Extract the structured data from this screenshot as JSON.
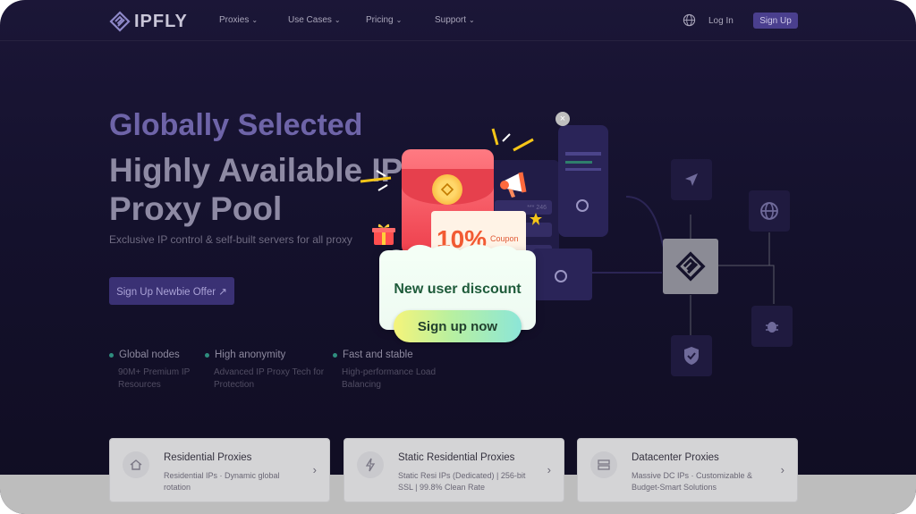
{
  "brand": {
    "name": "IPFLY"
  },
  "nav": {
    "items": [
      {
        "label": "Proxies"
      },
      {
        "label": "Use Cases"
      },
      {
        "label": "Pricing"
      },
      {
        "label": "Support"
      }
    ],
    "login_label": "Log In",
    "signup_label": "Sign Up"
  },
  "hero": {
    "title_line1": "Globally Selected",
    "title_line2": "Highly Available IP",
    "title_line3": "Proxy Pool",
    "subtitle": "Exclusive IP control & self-built servers for all proxy",
    "cta_label": "Sign Up Newbie Offer ↗",
    "features": [
      {
        "title": "Global nodes",
        "desc": "90M+ Premium IP Resources"
      },
      {
        "title": "High anonymity",
        "desc": "Advanced IP Proxy Tech for Protection"
      },
      {
        "title": "Fast and stable",
        "desc": "High-performance Load Balancing"
      }
    ]
  },
  "cards": [
    {
      "title": "Residential Proxies",
      "desc": "Residential IPs · Dynamic global rotation",
      "icon": "home-icon"
    },
    {
      "title": "Static Residential Proxies",
      "desc": "Static Resi IPs (Dedicated) | 256-bit SSL | 99.8% Clean Rate",
      "icon": "bolt-icon"
    },
    {
      "title": "Datacenter Proxies",
      "desc": "Massive DC IPs · Customizable & Budget-Smart Solutions",
      "icon": "server-icon"
    }
  ],
  "popup": {
    "coupon_percent": "10%",
    "coupon_label": "Coupon",
    "title": "New user discount",
    "button_label": "Sign up now",
    "close_symbol": "×"
  },
  "illustration": {
    "phone_text": "*** 246"
  },
  "colors": {
    "accent": "#4a3f8e",
    "popup_title": "#1e5b3a",
    "coupon": "#f25b33",
    "feature_dot": "#2f8d7e"
  }
}
